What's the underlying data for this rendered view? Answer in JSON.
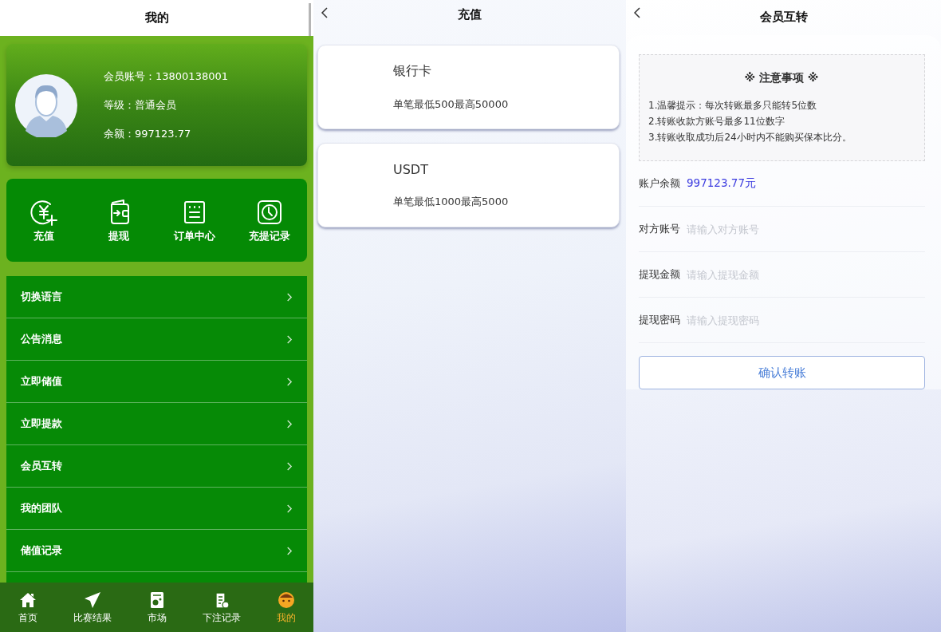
{
  "mine": {
    "title": "我的",
    "profile": {
      "account": "会员账号：13800138001",
      "level": "等级：普通会员",
      "balance": "余额：997123.77"
    },
    "quick_actions": [
      {
        "kind": "deposit",
        "label": "充值"
      },
      {
        "kind": "withdraw",
        "label": "提现"
      },
      {
        "kind": "orders",
        "label": "订单中心"
      },
      {
        "kind": "history",
        "label": "充提记录"
      }
    ],
    "menu": [
      "切换语言",
      "公告消息",
      "立即储值",
      "立即提款",
      "会员互转",
      "我的团队",
      "储值记录"
    ],
    "nav": [
      {
        "kind": "home",
        "label": "首页",
        "selected": false
      },
      {
        "kind": "results",
        "label": "比赛结果",
        "selected": false
      },
      {
        "kind": "market",
        "label": "市场",
        "selected": false
      },
      {
        "kind": "bets",
        "label": "下注记录",
        "selected": false
      },
      {
        "kind": "me",
        "label": "我的",
        "selected": true
      }
    ]
  },
  "recharge": {
    "title": "充值",
    "methods": [
      {
        "name": "银行卡",
        "limits": "单笔最低500最高50000"
      },
      {
        "name": "USDT",
        "limits": "单笔最低1000最高5000"
      }
    ]
  },
  "transfer": {
    "title": "会员互转",
    "notice": {
      "title": "※ 注意事项 ※",
      "lines": [
        "1.温馨提示：每次转账最多只能转5位数",
        "2.转账收款方账号最多11位数字",
        "3.转账收取成功后24小时内不能购买保本比分。"
      ]
    },
    "balance": {
      "label": "账户余额",
      "value": "997123.77元"
    },
    "fields": [
      {
        "label": "对方账号",
        "placeholder": "请输入对方账号"
      },
      {
        "label": "提现金额",
        "placeholder": "请输入提现金额"
      },
      {
        "label": "提现密码",
        "placeholder": "请输入提现密码"
      }
    ],
    "button": "确认转账"
  }
}
